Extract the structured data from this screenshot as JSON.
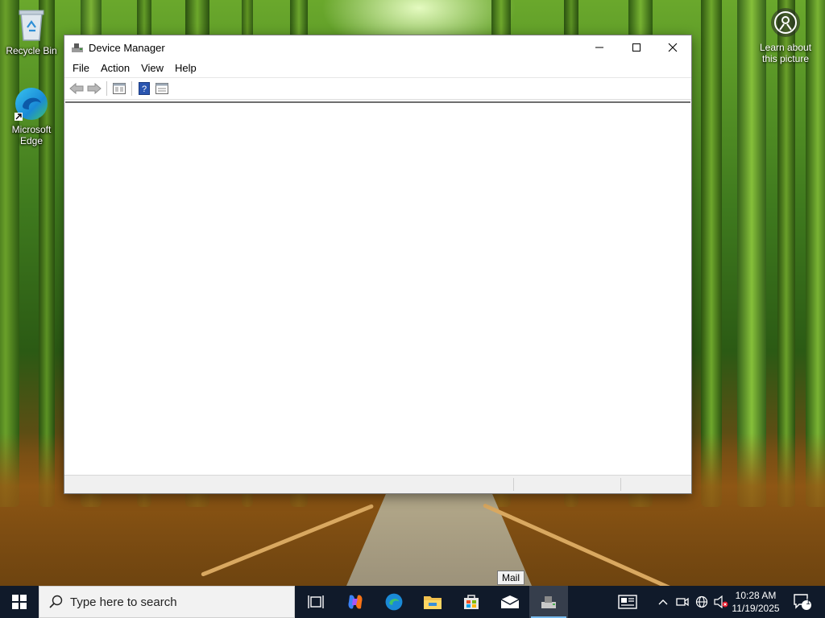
{
  "desktop": {
    "icons": [
      {
        "label": "Recycle Bin"
      },
      {
        "label": "Microsoft Edge"
      }
    ],
    "learn_about": "Learn about this picture"
  },
  "window": {
    "title": "Device Manager",
    "menu": [
      "File",
      "Action",
      "View",
      "Help"
    ]
  },
  "taskbar": {
    "search_placeholder": "Type here to search",
    "tooltip": "Mail",
    "clock": {
      "time": "10:28 AM",
      "date": "11/19/2025"
    },
    "notification_count": "1"
  },
  "colors": {
    "taskbar_bg": "#101a2a",
    "accent": "#0078d7"
  }
}
